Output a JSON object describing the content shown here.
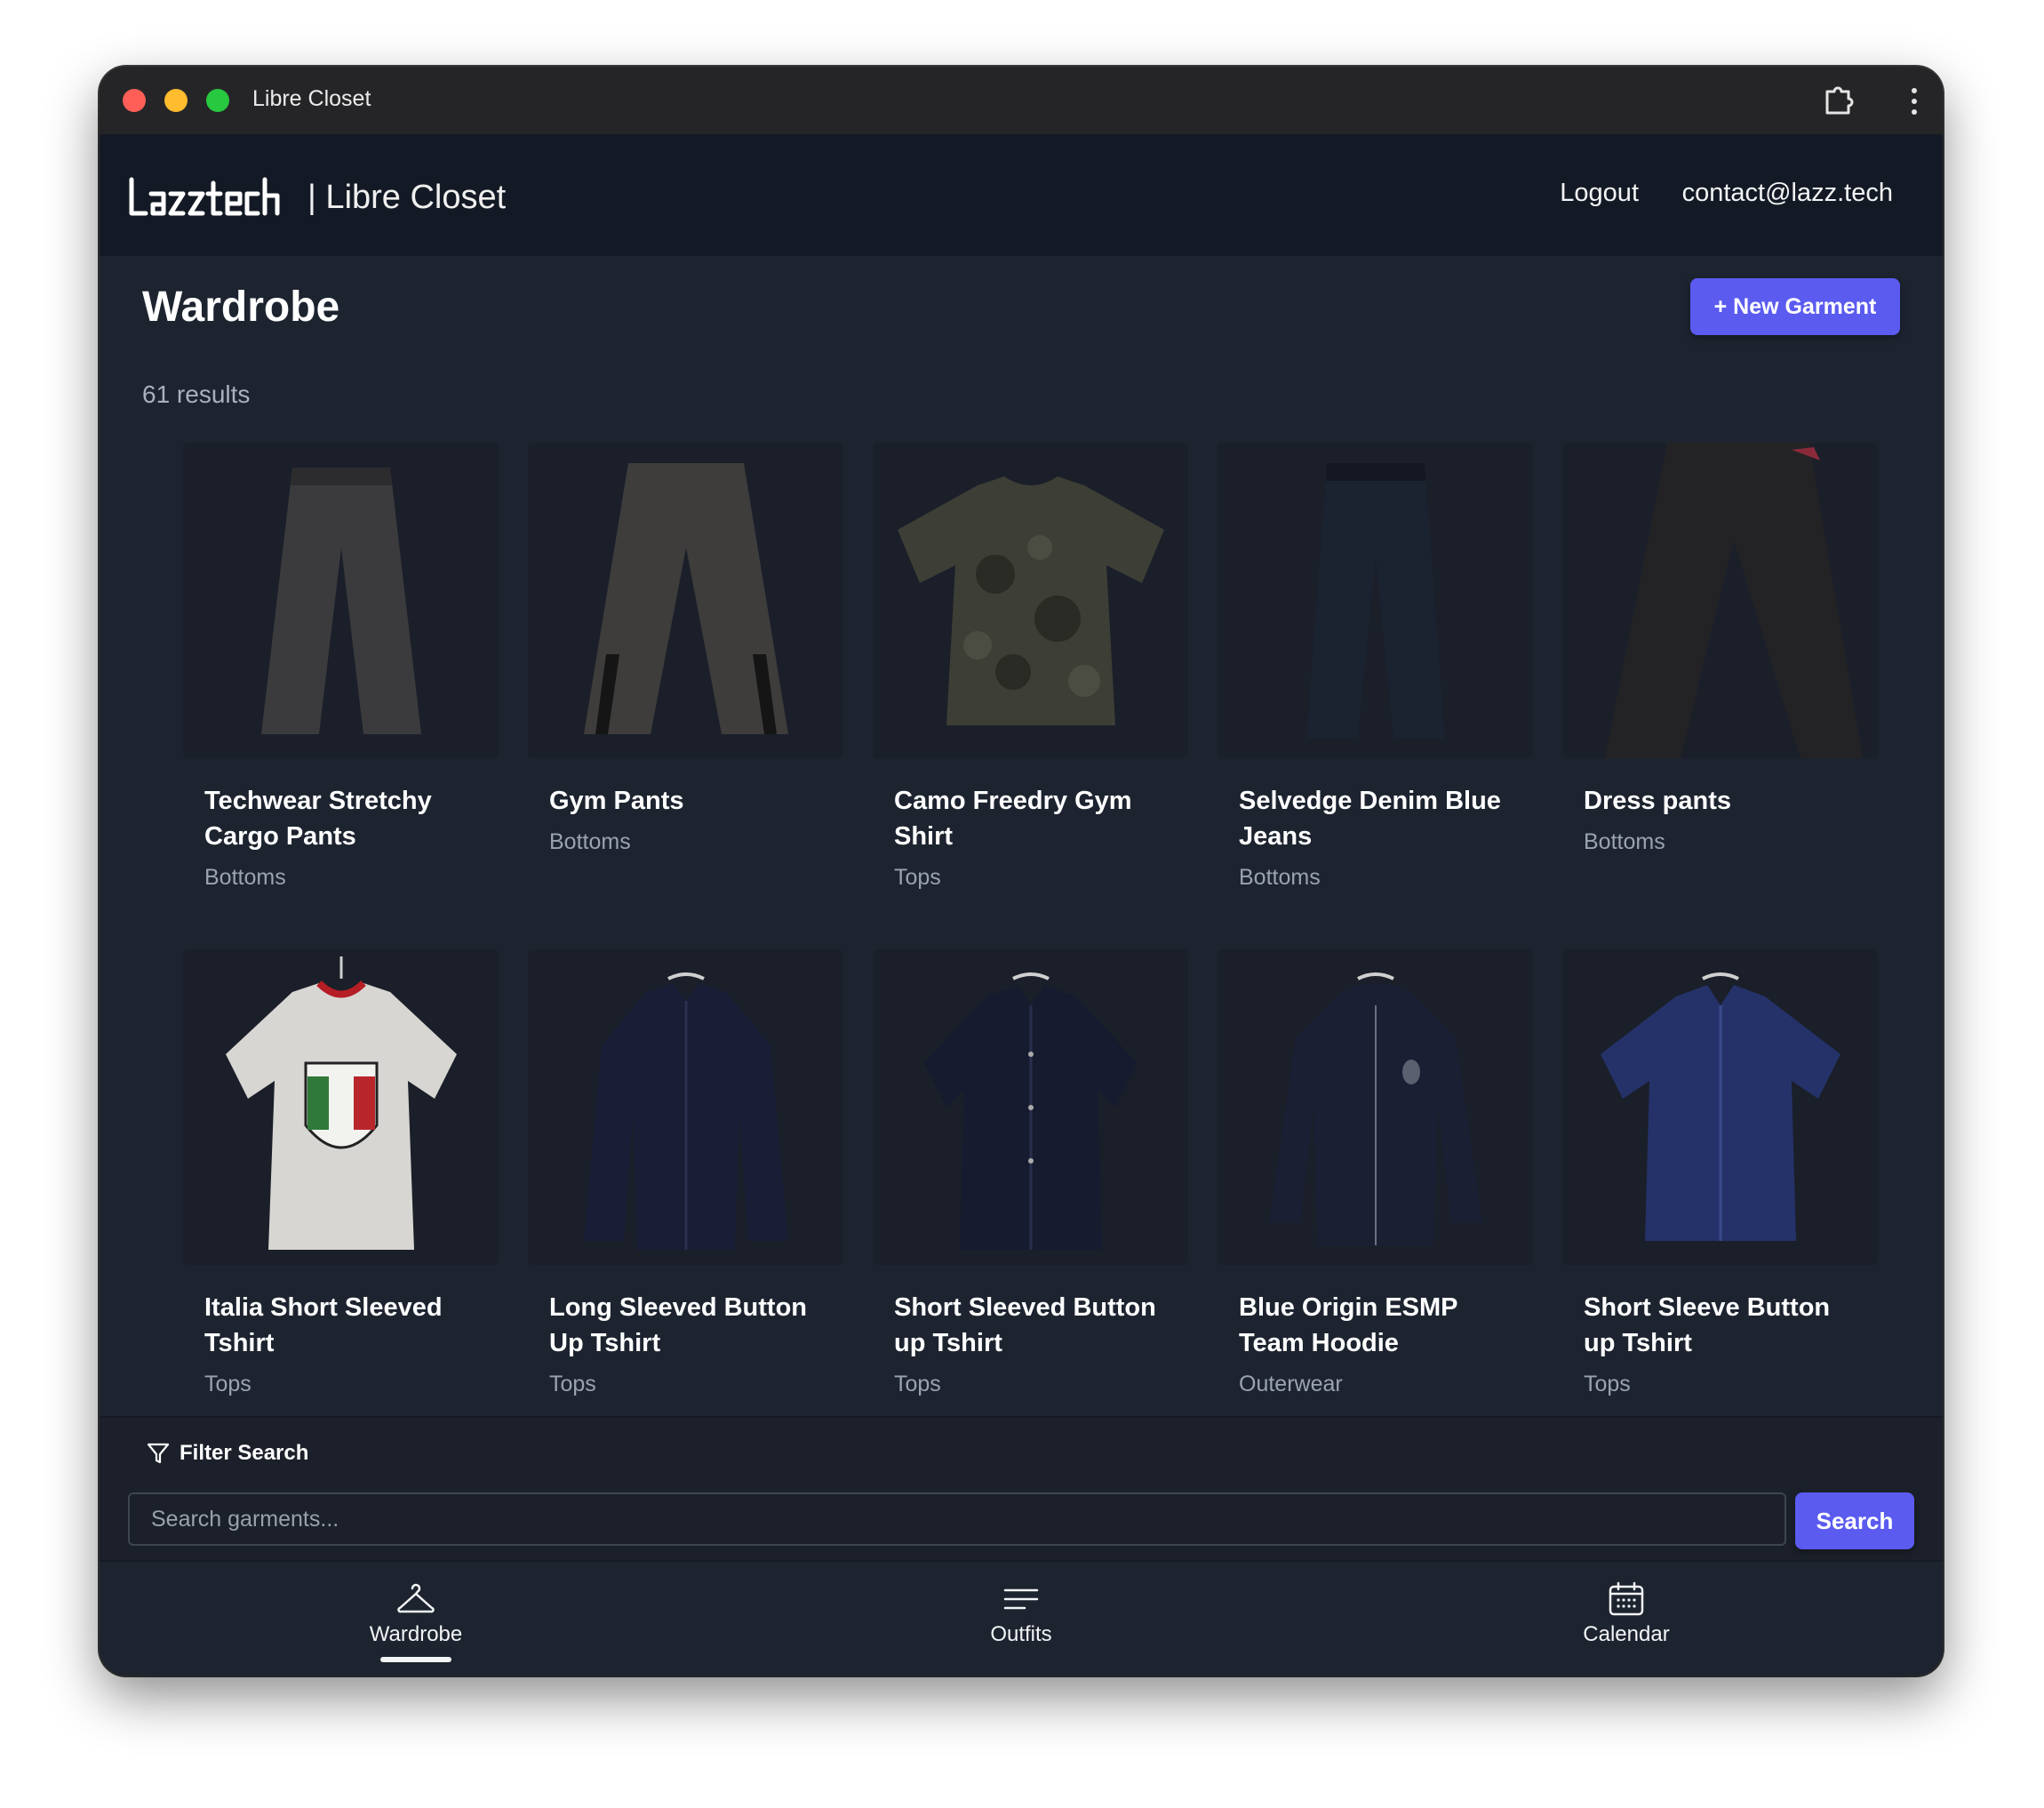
{
  "window": {
    "title": "Libre Closet"
  },
  "header": {
    "brand": "Lazztech",
    "separator": "| Libre Closet",
    "links": {
      "logout": "Logout",
      "contact": "contact@lazz.tech"
    }
  },
  "page": {
    "title": "Wardrobe",
    "new_button": "+ New Garment",
    "results": "61 results"
  },
  "garments": [
    {
      "name": "Techwear Stretchy Cargo Pants",
      "category": "Bottoms"
    },
    {
      "name": "Gym Pants",
      "category": "Bottoms"
    },
    {
      "name": "Camo Freedry Gym Shirt",
      "category": "Tops"
    },
    {
      "name": "Selvedge Denim Blue Jeans",
      "category": "Bottoms"
    },
    {
      "name": "Dress pants",
      "category": "Bottoms"
    },
    {
      "name": "Italia Short Sleeved Tshirt",
      "category": "Tops"
    },
    {
      "name": "Long Sleeved Button Up Tshirt",
      "category": "Tops"
    },
    {
      "name": "Short Sleeved Button up Tshirt",
      "category": "Tops"
    },
    {
      "name": "Blue Origin ESMP Team Hoodie",
      "category": "Outerwear"
    },
    {
      "name": "Short Sleeve Button up Tshirt",
      "category": "Tops"
    }
  ],
  "filter": {
    "label": "Filter Search",
    "placeholder": "Search garments...",
    "button": "Search"
  },
  "bottom_nav": {
    "wardrobe": "Wardrobe",
    "outfits": "Outfits",
    "calendar": "Calendar"
  },
  "colors": {
    "accent": "#5b5bf0",
    "background": "#1d2430",
    "header": "#141a25"
  }
}
